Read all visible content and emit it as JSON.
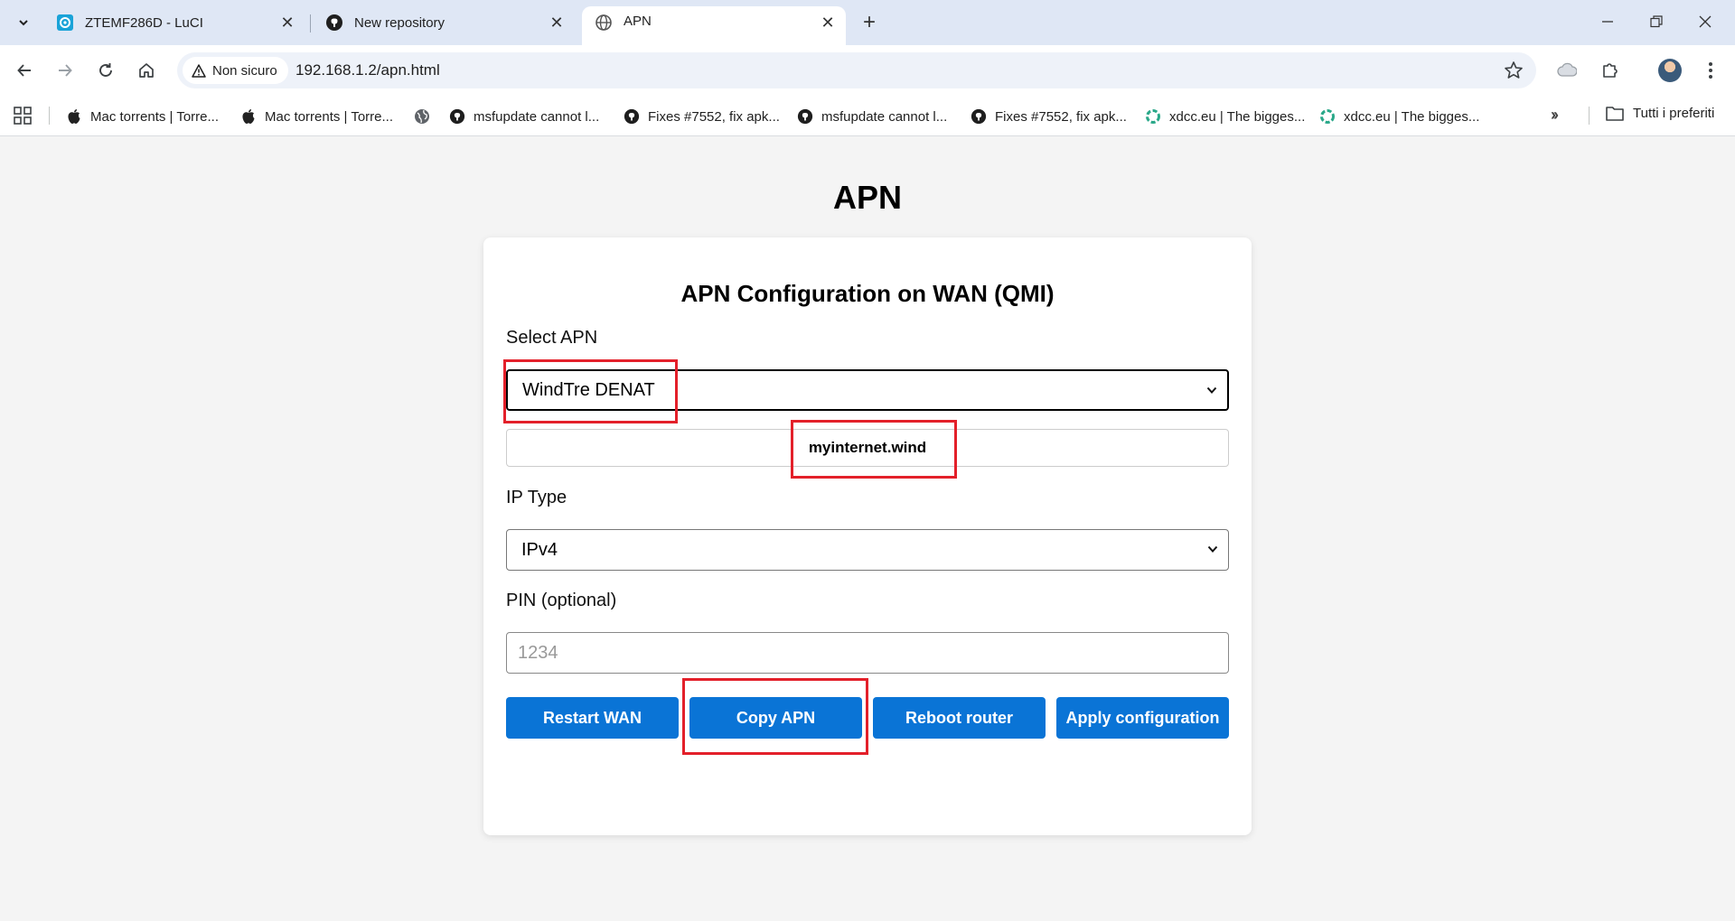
{
  "browser": {
    "tabs": [
      {
        "title": "ZTEMF286D - LuCI",
        "icon": "luci-icon",
        "active": false
      },
      {
        "title": "New repository",
        "icon": "github-icon",
        "active": false
      },
      {
        "title": "APN",
        "icon": "globe-icon",
        "active": true
      }
    ],
    "security_chip": "Non sicuro",
    "url": "192.168.1.2/apn.html",
    "bookmarks": [
      {
        "label": "Mac torrents | Torre...",
        "icon": "apple-icon"
      },
      {
        "label": "Mac torrents | Torre...",
        "icon": "apple-icon"
      },
      {
        "label": "",
        "icon": "globe-icon"
      },
      {
        "label": "msfupdate cannot l...",
        "icon": "github-icon"
      },
      {
        "label": "Fixes #7552, fix apk...",
        "icon": "github-icon"
      },
      {
        "label": "msfupdate cannot l...",
        "icon": "github-icon"
      },
      {
        "label": "Fixes #7552, fix apk...",
        "icon": "github-icon"
      },
      {
        "label": "xdcc.eu | The bigges...",
        "icon": "xdcc-icon"
      },
      {
        "label": "xdcc.eu | The bigges...",
        "icon": "xdcc-icon"
      }
    ],
    "all_bookmarks_label": "Tutti i preferiti"
  },
  "page": {
    "title": "APN",
    "card_title": "APN Configuration on WAN (QMI)",
    "select_apn_label": "Select APN",
    "select_apn_value": "WindTre DENAT",
    "apn_value": "myinternet.wind",
    "ip_type_label": "IP Type",
    "ip_type_value": "IPv4",
    "pin_label": "PIN (optional)",
    "pin_placeholder": "1234",
    "buttons": {
      "restart_wan": "Restart WAN",
      "copy_apn": "Copy APN",
      "reboot_router": "Reboot router",
      "apply_configuration": "Apply configuration"
    }
  },
  "colors": {
    "button_blue": "#0a74d6",
    "annotation_red": "#e3202a",
    "tabstrip_bg": "#dfe7f5"
  }
}
